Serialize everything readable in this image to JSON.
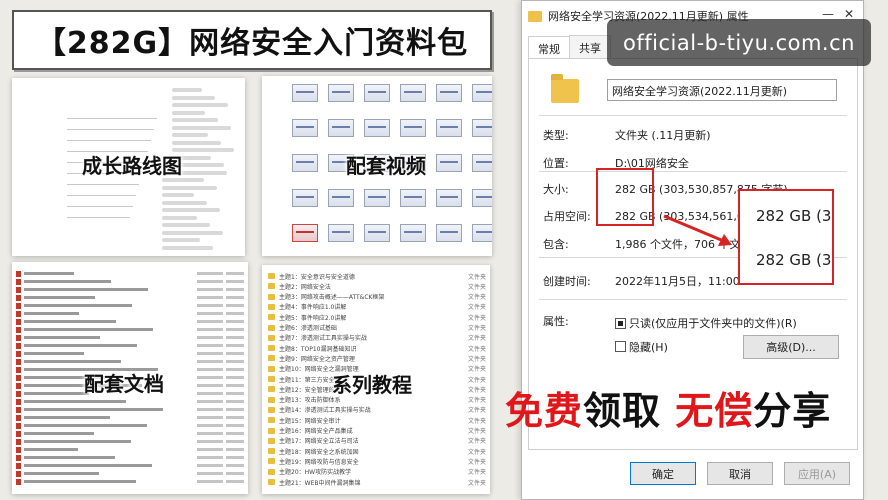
{
  "poster": {
    "title": "【282G】网络安全入门资料包",
    "labels": {
      "roadmap": "成长路线图",
      "video": "配套视频",
      "docs": "配套文档",
      "tutorial": "系列教程"
    },
    "banner": {
      "part1": "免费",
      "part2": "领取 ",
      "part3": "无偿",
      "part4": "分享"
    },
    "tutorial_items": [
      "主题1：安全意识与安全道德",
      "主题2：网络安全法",
      "主题3：网络攻击概述——ATT&CK框架",
      "主题4：事件响应1.0讲解",
      "主题5：事件响应2.0讲解",
      "主题6：渗透测试基础",
      "主题7：渗透测试工具实操与实战",
      "主题8：TOP10漏洞基础知识",
      "主题9：网络安全之资产管理",
      "主题10：网络安全之漏洞管理",
      "主题11：第三方安全管理",
      "主题12：安全管理的框架",
      "主题13：攻击防御体系",
      "主题14：渗透测试工具实操与实战",
      "主题15：网络安全审计",
      "主题16：网络安全产品集成",
      "主题17：网络安全立法与司法",
      "主题18：网络安全之系统加固",
      "主题19：网络攻防与信息安全",
      "主题20：HW攻防实战教学",
      "主题21：WEB中间件漏洞集锦"
    ],
    "tutorial_type": "文件夹"
  },
  "dialog": {
    "title": "网络安全学习资源(2022.11月更新) 属性",
    "controls": {
      "minimize": "—",
      "close": "✕"
    },
    "tabs": [
      "常规",
      "共享"
    ],
    "folder_name": "网络安全学习资源(2022.11月更新)",
    "props": {
      "type_label": "类型:",
      "type_value": "文件夹 (.11月更新)",
      "location_label": "位置:",
      "location_value": "D:\\01网络安全",
      "size_label": "大小:",
      "size_value": "282 GB (303,530,857,875 字节)",
      "disk_label": "占用空间:",
      "disk_value": "282 GB (303,534,561,632 字节)",
      "contains_label": "包含:",
      "contains_value": "1,986 个文件，706 个文件夹",
      "created_label": "创建时间:",
      "created_value": "2022年11月5日，11:00:13",
      "attr_label": "属性:",
      "readonly_label": "只读(仅应用于文件夹中的文件)(R)",
      "hidden_label": "隐藏(H)",
      "advanced_label": "高级(D)..."
    },
    "buttons": {
      "ok": "确定",
      "cancel": "取消",
      "apply": "应用(A)"
    },
    "zoom": {
      "line1": "282 GB (3",
      "line2": "282 GB (3"
    }
  },
  "watermark": "official-b-tiyu.com.cn",
  "colors": {
    "accent_red": "#d62323",
    "banner_red": "#e0171a",
    "folder": "#efc34c"
  }
}
